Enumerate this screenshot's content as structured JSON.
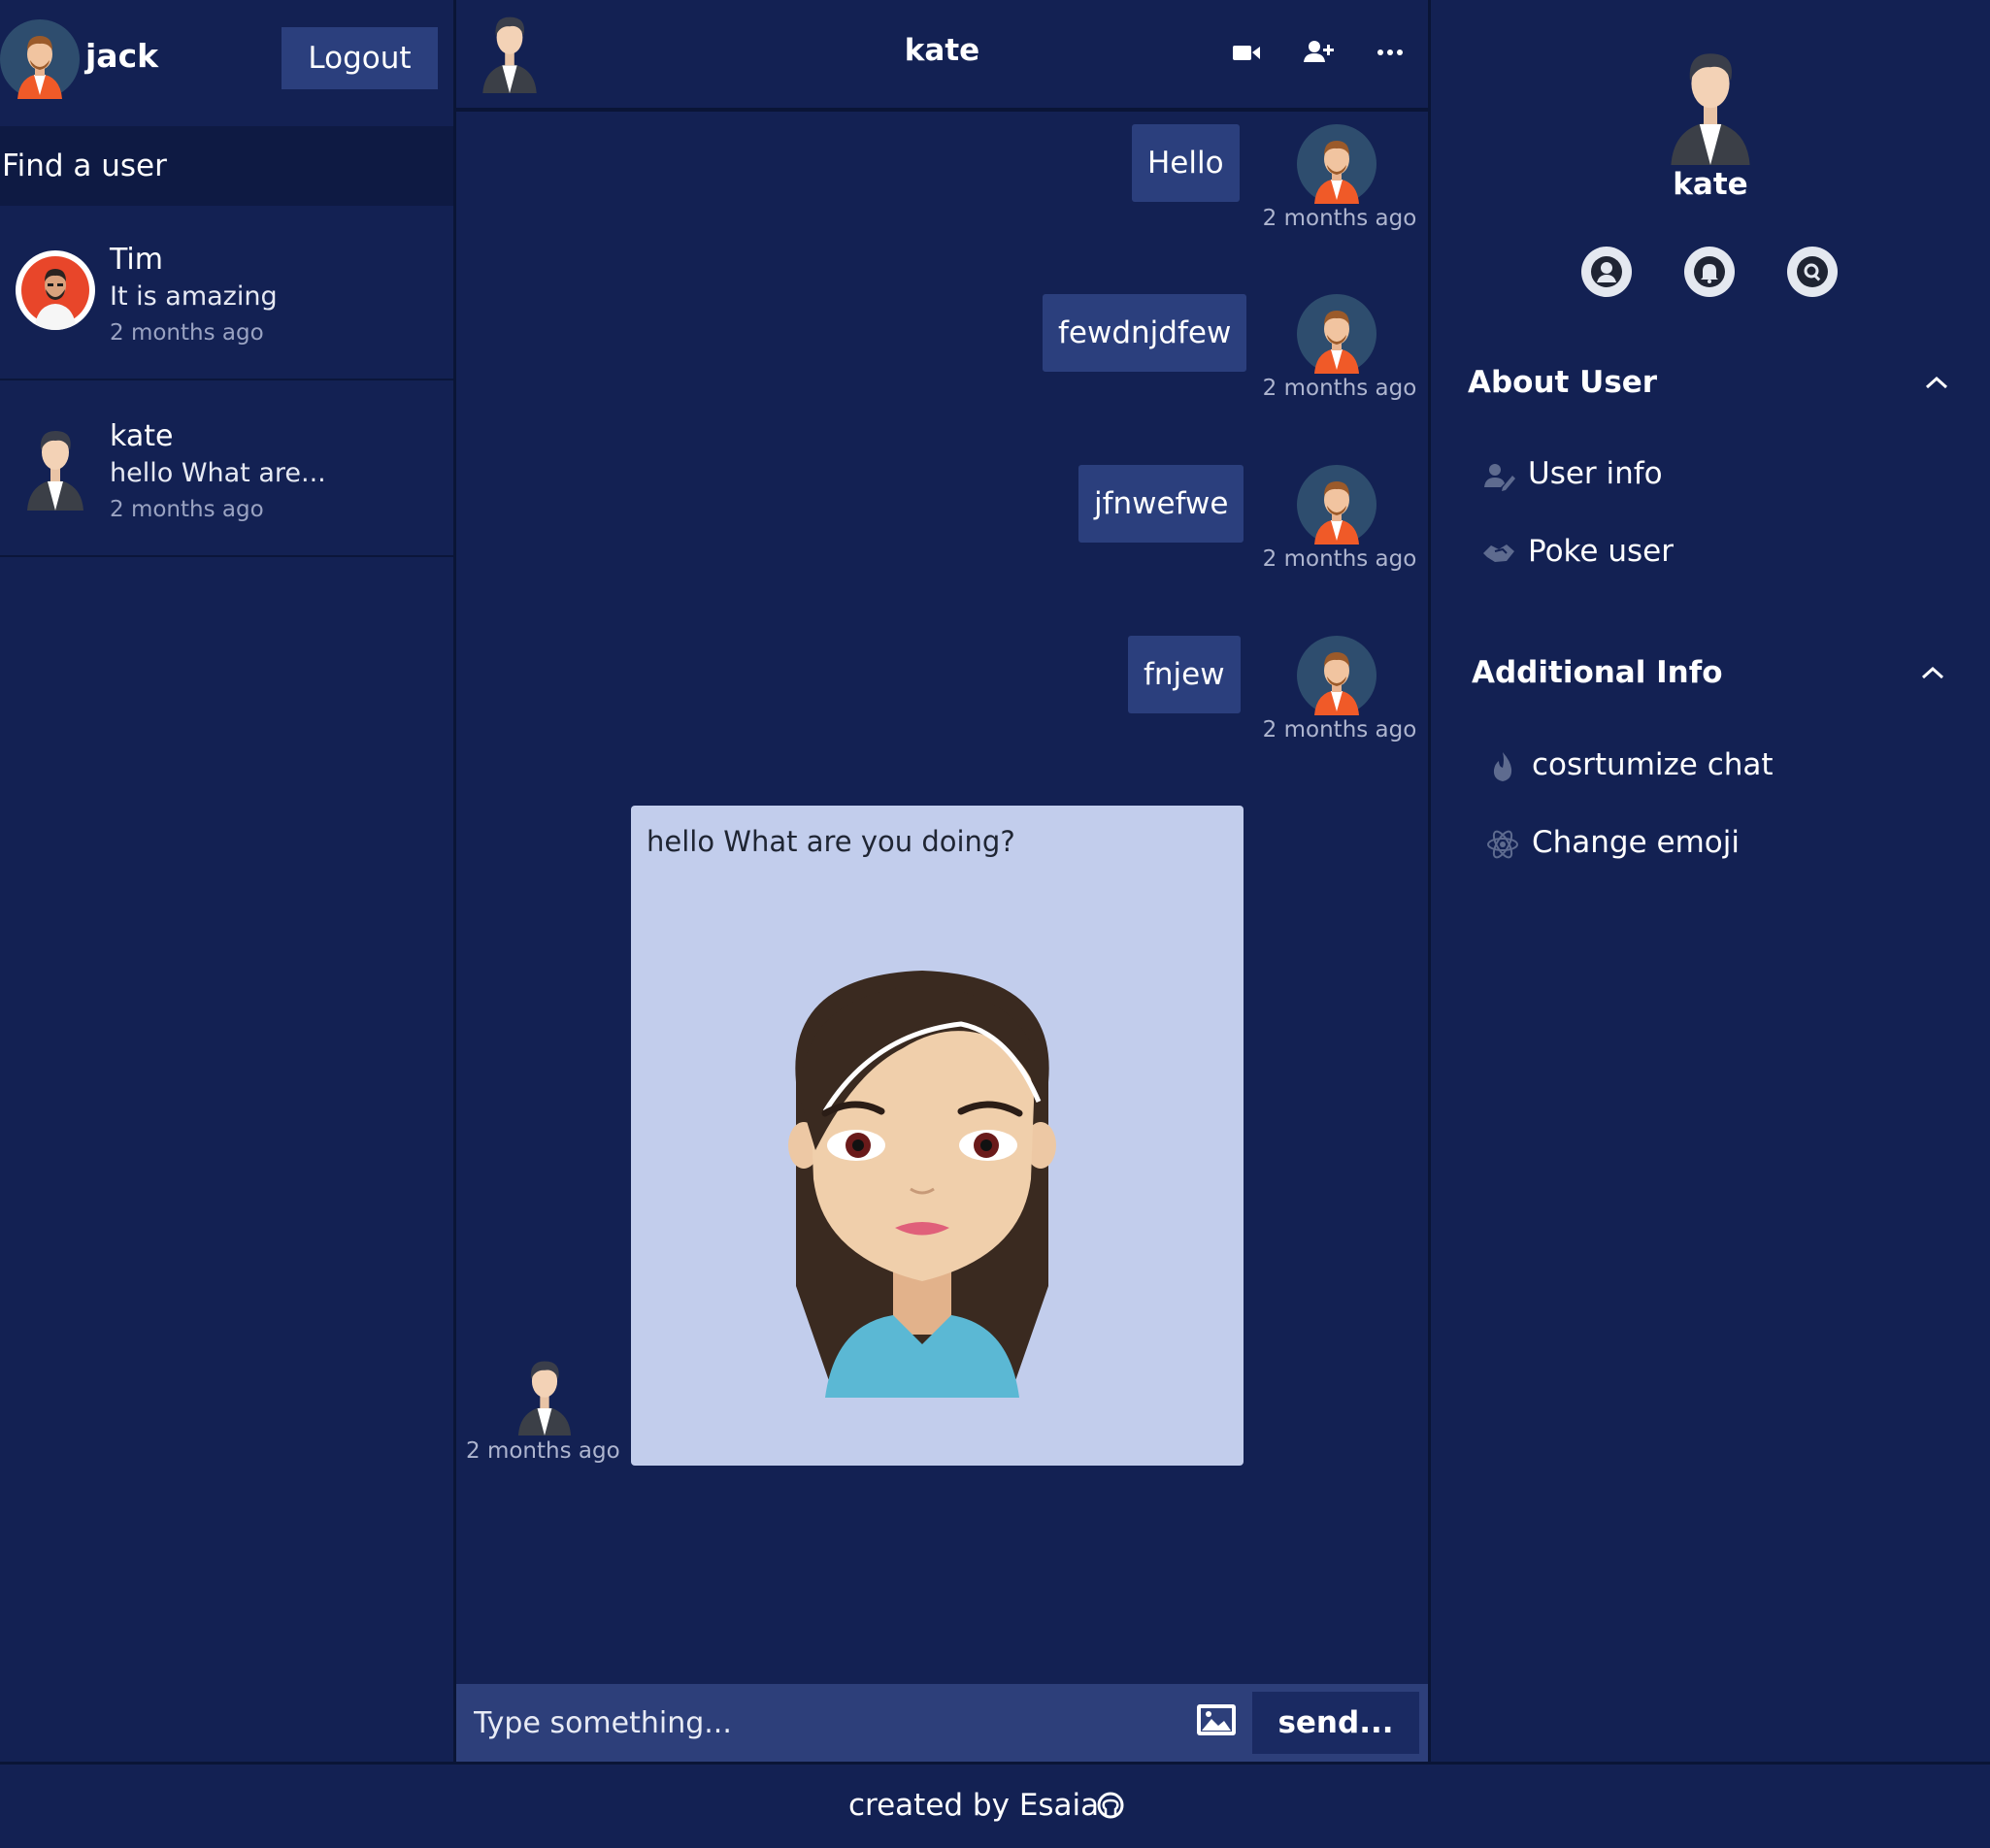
{
  "sidebar": {
    "current_user": "jack",
    "logout_label": "Logout",
    "search_placeholder": "Find a user",
    "conversations": [
      {
        "name": "Tim",
        "last_message": "It is amazing",
        "time": "2 months ago",
        "avatar": "man-beard-red-icon"
      },
      {
        "name": "kate",
        "last_message": "hello What are...",
        "time": "2 months ago",
        "avatar": "businessman-icon"
      }
    ]
  },
  "chat": {
    "title": "kate",
    "header_icons": [
      "video-camera-icon",
      "add-user-icon",
      "more-icon"
    ],
    "messages_out": [
      {
        "text": "Hello",
        "time": "2 months ago"
      },
      {
        "text": "fewdnjdfew",
        "time": "2 months ago"
      },
      {
        "text": "jfnwefwe",
        "time": "2 months ago"
      },
      {
        "text": "fnjew",
        "time": "2 months ago"
      }
    ],
    "message_in": {
      "text": "hello What are you doing?",
      "time": "2 months ago",
      "image": "cartoon-girl-image"
    },
    "composer": {
      "placeholder": "Type something...",
      "send_label": "send..."
    }
  },
  "panel": {
    "name": "kate",
    "round_icons": [
      "user-circle-icon",
      "bell-icon",
      "search-icon"
    ],
    "about": {
      "title": "About User",
      "items": [
        {
          "label": "User info",
          "icon": "user-edit-icon"
        },
        {
          "label": "Poke user",
          "icon": "handshake-icon"
        }
      ]
    },
    "additional": {
      "title": "Additional Info",
      "items": [
        {
          "label": "cosrtumize chat",
          "icon": "fire-icon"
        },
        {
          "label": "Change emoji",
          "icon": "atom-icon"
        }
      ]
    }
  },
  "footer": {
    "text": "created by Esaia",
    "icon": "github-icon"
  },
  "colors": {
    "background": "#132153",
    "bubble": "#2b3f7d",
    "composer": "#2d3f7a",
    "incoming_card": "#c2cdec",
    "accent_orange": "#f05a28"
  }
}
